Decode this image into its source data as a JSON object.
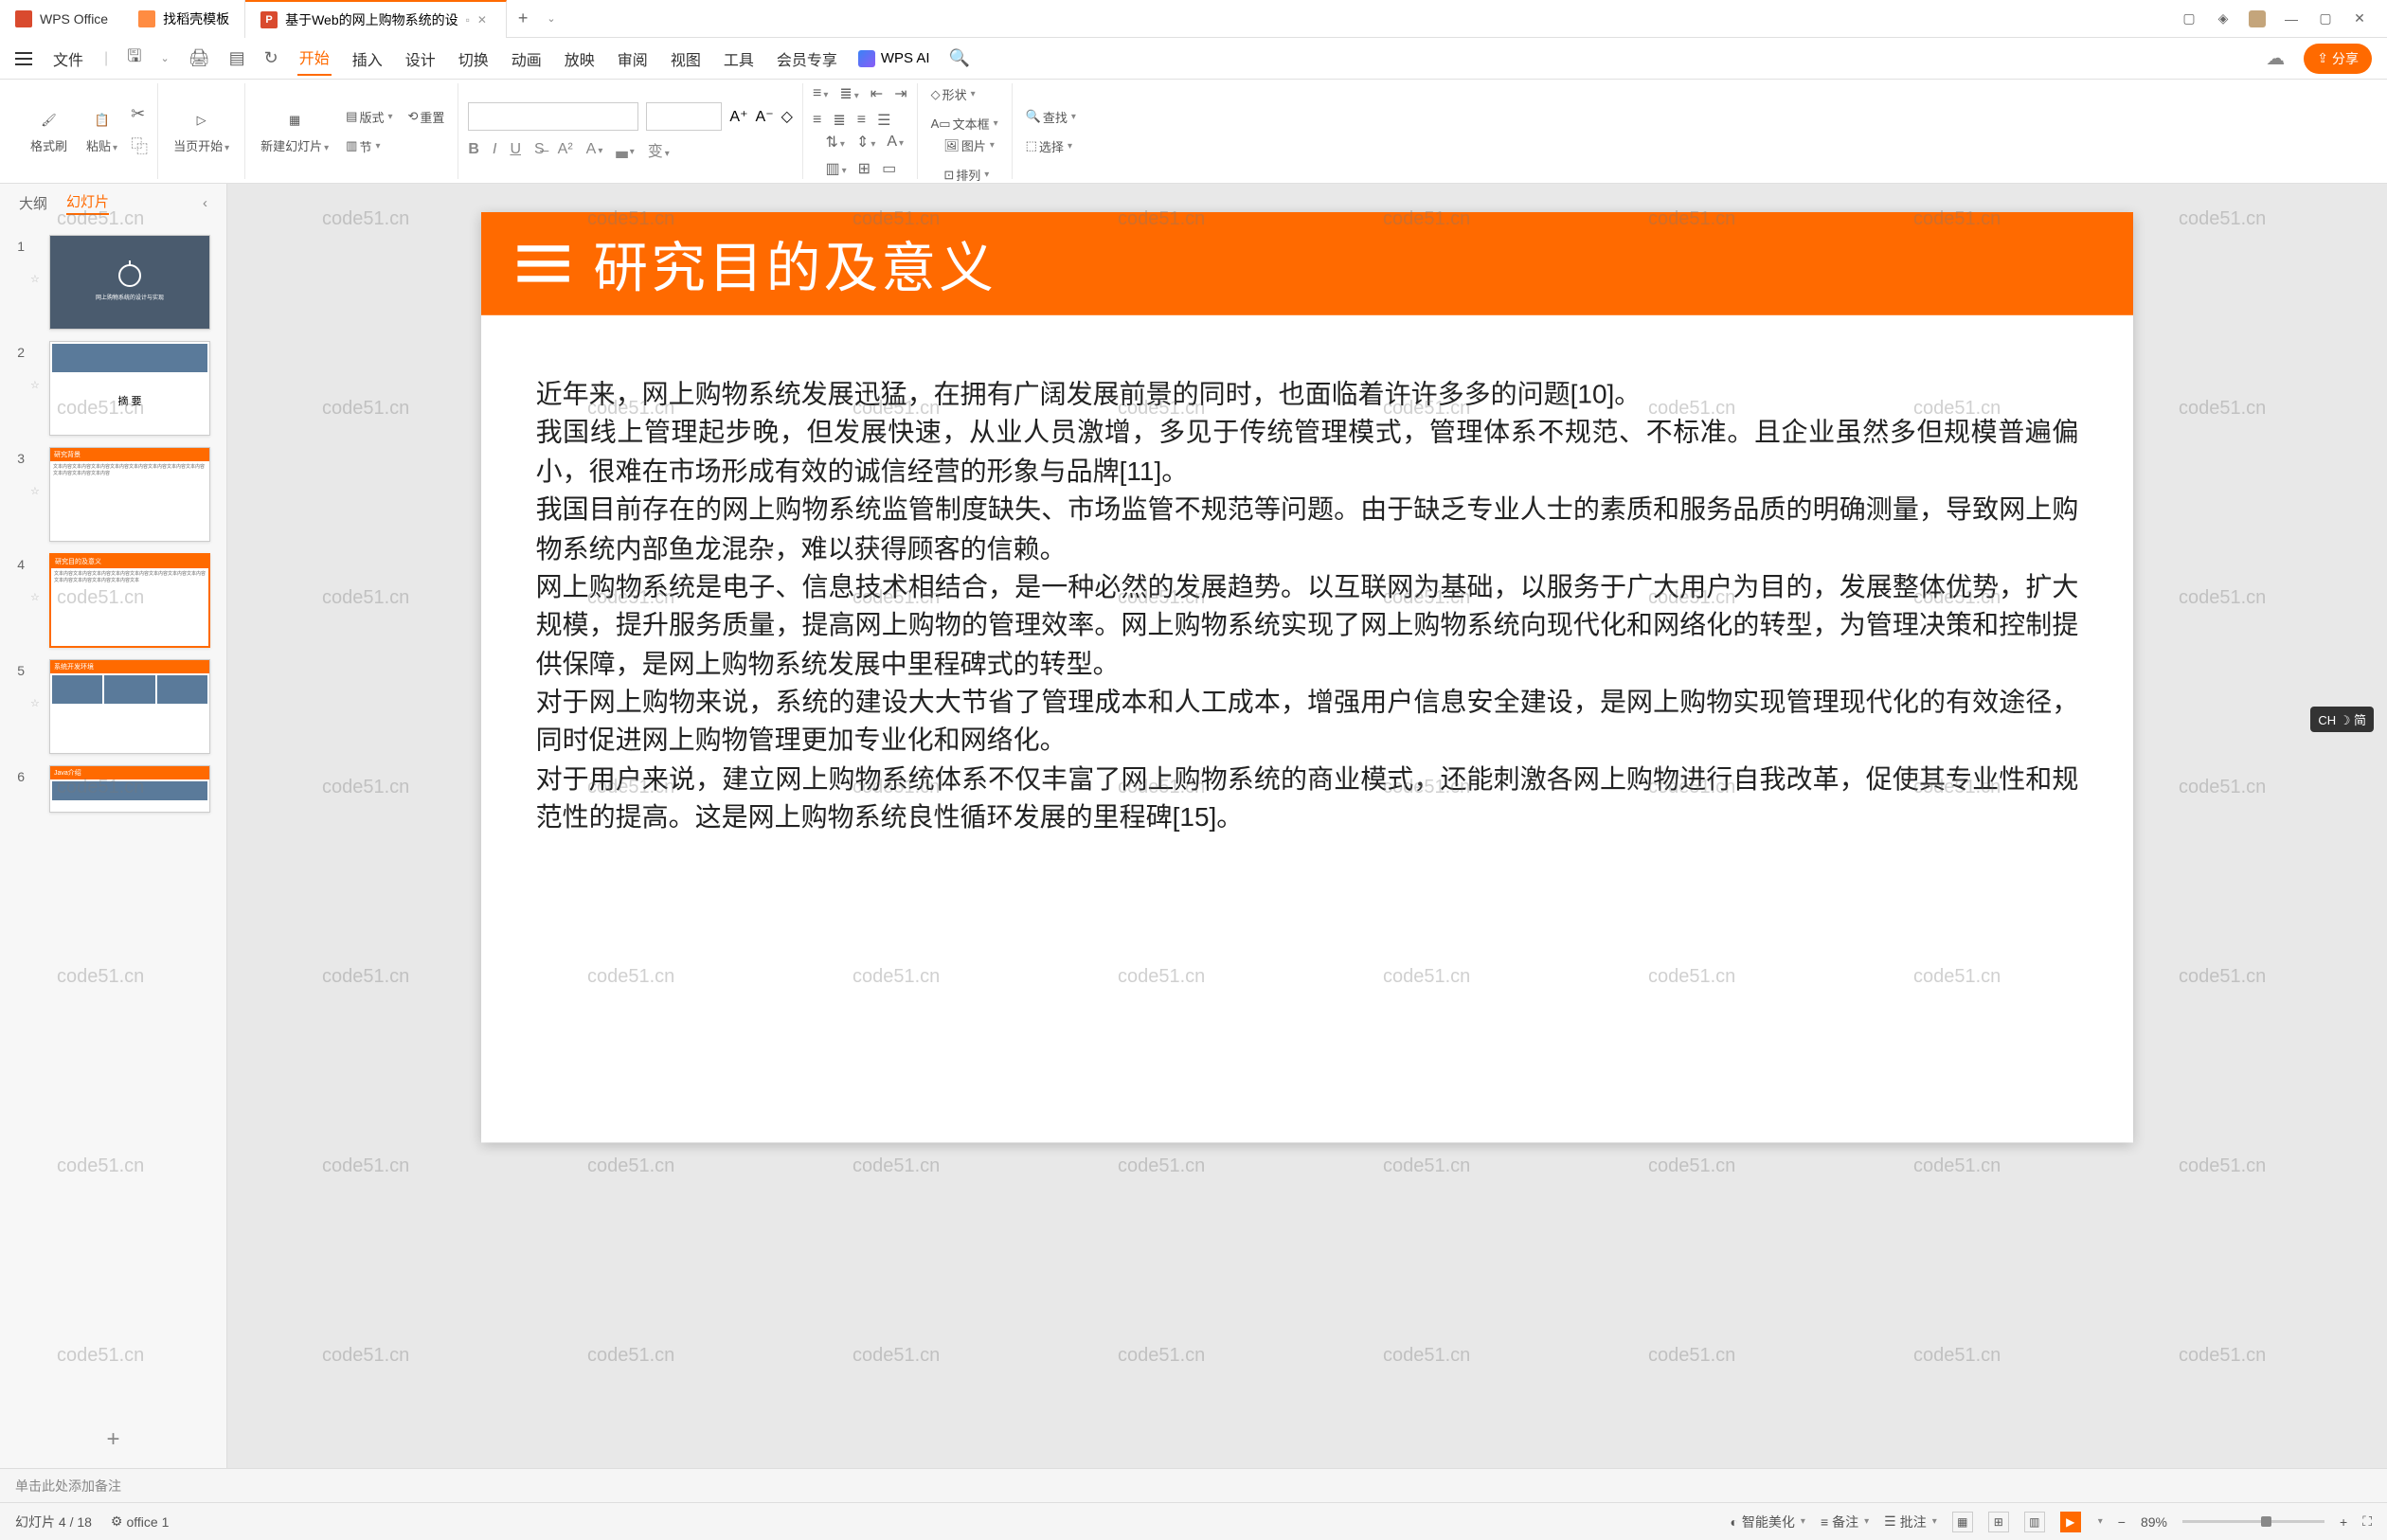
{
  "tabs": {
    "home": "WPS Office",
    "doc1": "找稻壳模板",
    "doc2": "基于Web的网上购物系统的设",
    "add": "+"
  },
  "window_controls": {
    "min": "—",
    "max": "▢",
    "close": "✕"
  },
  "quickbar": {
    "file": "文件"
  },
  "menu": {
    "items": [
      "开始",
      "插入",
      "设计",
      "切换",
      "动画",
      "放映",
      "审阅",
      "视图",
      "工具",
      "会员专享"
    ],
    "active": "开始",
    "wps_ai": "WPS AI",
    "share": "分享"
  },
  "ribbon": {
    "format_brush": "格式刷",
    "paste": "粘贴",
    "current_page": "当页开始",
    "new_slide": "新建幻灯片",
    "layout": "版式",
    "section": "节",
    "reset": "重置",
    "shape": "形状",
    "image": "图片",
    "textbox": "文本框",
    "arrange": "排列",
    "find": "查找",
    "select": "选择"
  },
  "sidebar": {
    "tab_outline": "大纲",
    "tab_slides": "幻灯片",
    "slides": [
      {
        "num": "1",
        "title": "网上购物系统的设计与实现"
      },
      {
        "num": "2",
        "title": "摘   要"
      },
      {
        "num": "3",
        "title": "研究背景"
      },
      {
        "num": "4",
        "title": "研究目的及意义"
      },
      {
        "num": "5",
        "title": "系统开发环境"
      },
      {
        "num": "6",
        "title": "Java介绍"
      }
    ]
  },
  "slide": {
    "title": "研究目的及意义",
    "body": "近年来，网上购物系统发展迅猛，在拥有广阔发展前景的同时，也面临着许许多多的问题[10]。\n我国线上管理起步晚，但发展快速，从业人员激增，多见于传统管理模式，管理体系不规范、不标准。且企业虽然多但规模普遍偏小，很难在市场形成有效的诚信经营的形象与品牌[11]。\n我国目前存在的网上购物系统监管制度缺失、市场监管不规范等问题。由于缺乏专业人士的素质和服务品质的明确测量，导致网上购物系统内部鱼龙混杂，难以获得顾客的信赖。\n网上购物系统是电子、信息技术相结合，是一种必然的发展趋势。以互联网为基础，以服务于广大用户为目的，发展整体优势，扩大规模，提升服务质量，提高网上购物的管理效率。网上购物系统实现了网上购物系统向现代化和网络化的转型，为管理决策和控制提供保障，是网上购物系统发展中里程碑式的转型。\n对于网上购物来说，系统的建设大大节省了管理成本和人工成本，增强用户信息安全建设，是网上购物实现管理现代化的有效途径，同时促进网上购物管理更加专业化和网络化。\n对于用户来说，建立网上购物系统体系不仅丰富了网上购物系统的商业模式，还能刺激各网上购物进行自我改革，促使其专业性和规范性的提高。这是网上购物系统良性循环发展的里程碑[15]。"
  },
  "watermark": "code51.cn",
  "notes": {
    "placeholder": "单击此处添加备注"
  },
  "status": {
    "slide_count": "幻灯片 4 / 18",
    "office": "office 1",
    "beautify": "智能美化",
    "remark": "备注",
    "review": "批注",
    "zoom": "89%"
  },
  "ime": "CH ☽ 简"
}
